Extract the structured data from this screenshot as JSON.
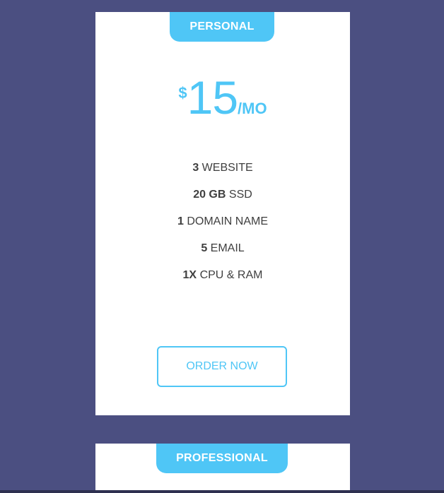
{
  "colors": {
    "background": "#4b4f81",
    "accent": "#4fc6f6",
    "card": "#ffffff",
    "text": "#3f3f3f"
  },
  "plans": [
    {
      "name": "PERSONAL",
      "price": {
        "currency": "$",
        "amount": "15",
        "period": "/MO"
      },
      "features": [
        {
          "qty": "3",
          "label": "WEBSITE"
        },
        {
          "qty": "20 GB",
          "label": "SSD"
        },
        {
          "qty": "1",
          "label": "DOMAIN NAME"
        },
        {
          "qty": "5",
          "label": "EMAIL"
        },
        {
          "qty": "1X",
          "label": "CPU & RAM"
        }
      ],
      "button_label": "ORDER NOW"
    },
    {
      "name": "PROFESSIONAL"
    }
  ]
}
